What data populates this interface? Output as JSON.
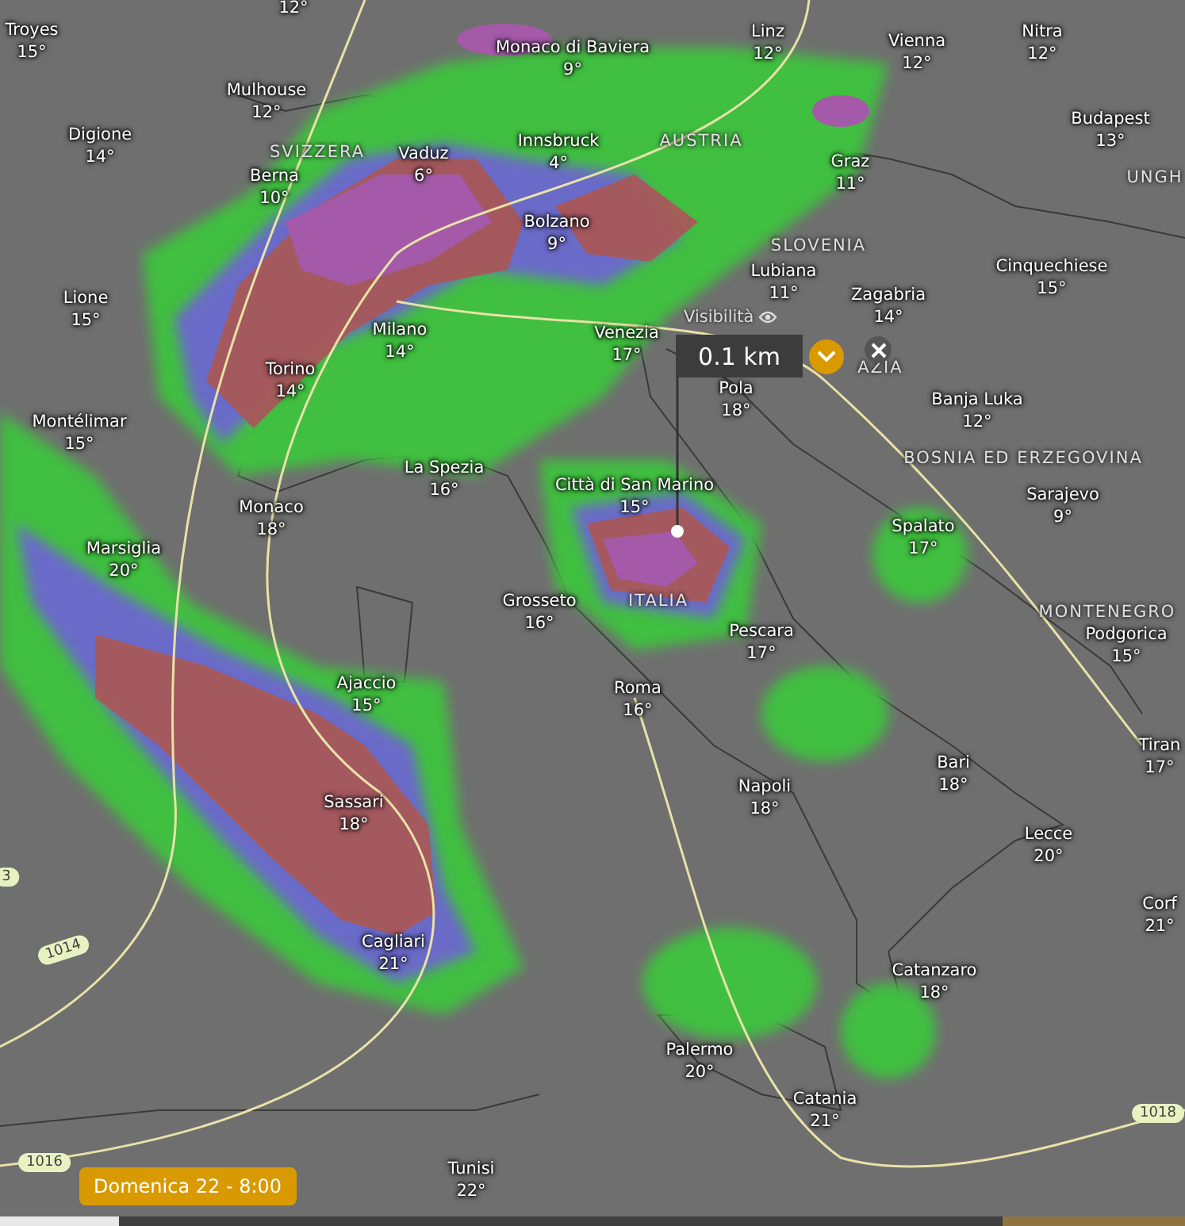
{
  "cities": [
    {
      "name": "Troyes",
      "temp": "15°"
    },
    {
      "temp": "12°"
    },
    {
      "name": "Monaco di Baviera",
      "temp": "9°"
    },
    {
      "name": "Linz",
      "temp": "12°"
    },
    {
      "name": "Vienna",
      "temp": "12°"
    },
    {
      "name": "Nitra",
      "temp": "12°"
    },
    {
      "name": "Mulhouse",
      "temp": "12°"
    },
    {
      "name": "Budapest",
      "temp": "13°"
    },
    {
      "name": "Digione",
      "temp": "14°"
    },
    {
      "name": "Vaduz",
      "temp": "6°"
    },
    {
      "name": "Innsbruck",
      "temp": "4°"
    },
    {
      "name": "Berna",
      "temp": "10°"
    },
    {
      "name": "Graz",
      "temp": "11°"
    },
    {
      "name": "Bolzano",
      "temp": "9°"
    },
    {
      "name": "Lubiana",
      "temp": "11°"
    },
    {
      "name": "Cinquechiese",
      "temp": "15°"
    },
    {
      "name": "Lione",
      "temp": "15°"
    },
    {
      "name": "Zagabria",
      "temp": "14°"
    },
    {
      "name": "Milano",
      "temp": "14°"
    },
    {
      "name": "Venezia",
      "temp": "17°"
    },
    {
      "name": "Torino",
      "temp": "14°"
    },
    {
      "name": "Pola",
      "temp": "18°"
    },
    {
      "name": "Banja Luka",
      "temp": "12°"
    },
    {
      "name": "Montélimar",
      "temp": "15°"
    },
    {
      "name": "La Spezia",
      "temp": "16°"
    },
    {
      "name": "Città di San Marino",
      "temp": "15°"
    },
    {
      "name": "Sarajevo",
      "temp": "9°"
    },
    {
      "name": "Monaco",
      "temp": "18°"
    },
    {
      "name": "Spalato",
      "temp": "17°"
    },
    {
      "name": "Marsiglia",
      "temp": "20°"
    },
    {
      "name": "Grosseto",
      "temp": "16°"
    },
    {
      "name": "Podgorica",
      "temp": "15°"
    },
    {
      "name": "Ajaccio",
      "temp": "15°"
    },
    {
      "name": "Pescara",
      "temp": "17°"
    },
    {
      "name": "Roma",
      "temp": "16°"
    },
    {
      "name": "Bari",
      "temp": "18°"
    },
    {
      "name": "Tiran",
      "temp": "17°"
    },
    {
      "name": "Napoli",
      "temp": "18°"
    },
    {
      "name": "Sassari",
      "temp": "18°"
    },
    {
      "name": "Lecce",
      "temp": "20°"
    },
    {
      "name": "Cagliari",
      "temp": "21°"
    },
    {
      "name": "Corf",
      "temp": "21°"
    },
    {
      "name": "Catanzaro",
      "temp": "18°"
    },
    {
      "name": "Palermo",
      "temp": "20°"
    },
    {
      "name": "Catania",
      "temp": "21°"
    },
    {
      "name": "Tunisi",
      "temp": "22°"
    }
  ],
  "countries": [
    "SVIZZERA",
    "AUSTRIA",
    "SLOVENIA",
    "UNGH",
    "AZIA",
    "BOSNIA ED ERZEGOVINA",
    "ITALIA",
    "MONTENEGRO"
  ],
  "isobars": [
    "1014",
    "1016",
    "1018",
    "3"
  ],
  "probe": {
    "title": "Visibilità",
    "value": "0.1 km"
  },
  "timeline": {
    "label": "Domenica 22 - 8:00",
    "level": 0.1
  }
}
